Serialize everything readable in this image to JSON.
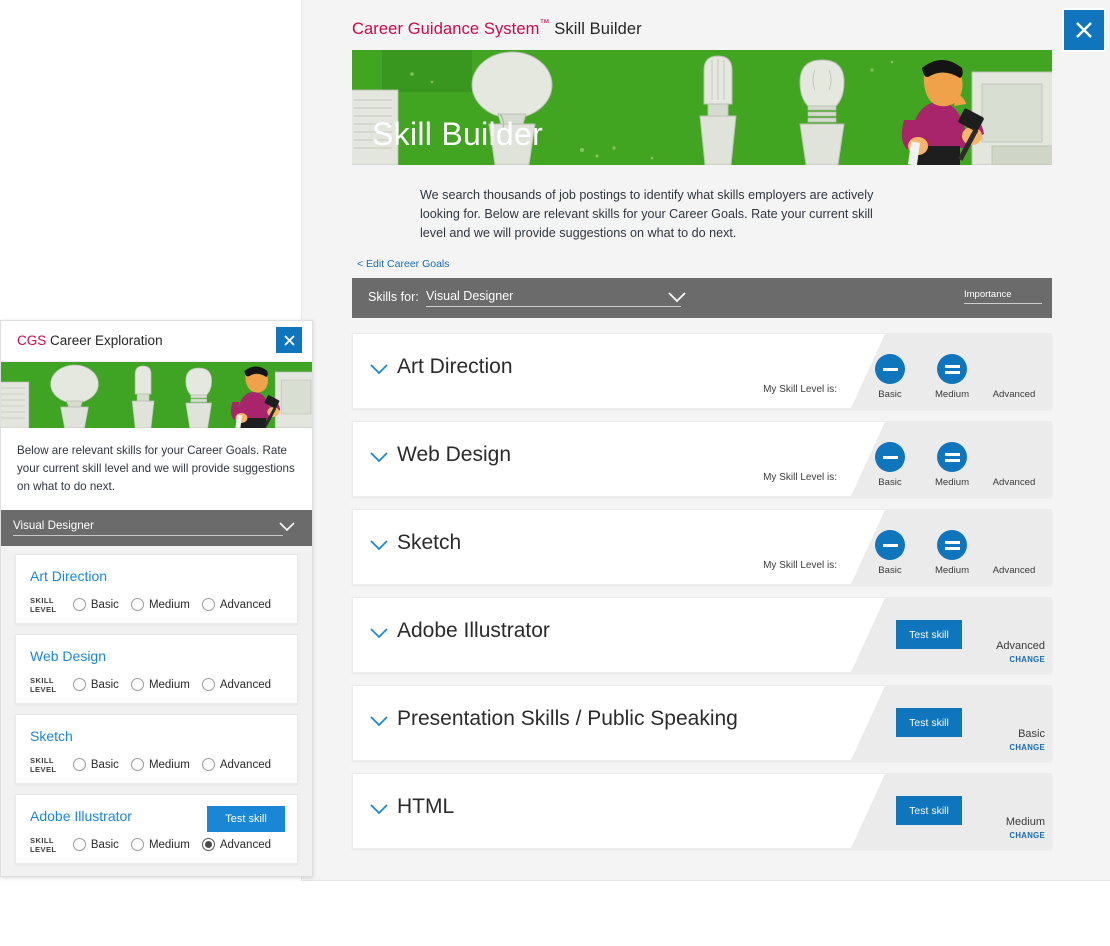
{
  "main": {
    "title_brand": "Career Guidance System",
    "title_tm": "™",
    "title_rest": " Skill Builder",
    "close_label": "close-icon",
    "hero_label": "Skill Builder",
    "intro": "We search thousands of job postings to identify what skills employers are actively looking for. Below are relevant skills for your Career Goals. Rate your current skill level and we will provide suggestions on what to do next.",
    "edit_goals": "< Edit Career Goals",
    "skills_for_label": "Skills for:",
    "skills_for_value": "Visual Designer",
    "importance_label": "Importance",
    "my_skill_level_label": "My Skill Level is:",
    "test_skill_label": "Test skill",
    "change_label": "CHANGE",
    "levels": [
      "Basic",
      "Medium",
      "Advanced"
    ],
    "rows": [
      {
        "name": "Art Direction",
        "mode": "rate"
      },
      {
        "name": "Web Design",
        "mode": "rate"
      },
      {
        "name": "Sketch",
        "mode": "rate"
      },
      {
        "name": "Adobe Illustrator",
        "mode": "tested",
        "result": "Advanced"
      },
      {
        "name": "Presentation Skills / Public Speaking",
        "mode": "tested",
        "result": "Basic"
      },
      {
        "name": "HTML",
        "mode": "tested",
        "result": "Medium"
      }
    ]
  },
  "side": {
    "title_brand": "CGS",
    "title_rest": " Career Exploration",
    "close_label": "close-icon",
    "intro": "Below are relevant skills for your Career Goals. Rate your current skill level and we will provide suggestions on what to do next.",
    "select_value": "Visual Designer",
    "skill_level_caption": "SKILL LEVEL",
    "test_skill_label": "Test skill",
    "levels": [
      "Basic",
      "Medium",
      "Advanced"
    ],
    "cards": [
      {
        "name": "Art Direction",
        "selected": null,
        "has_test": false
      },
      {
        "name": "Web Design",
        "selected": null,
        "has_test": false
      },
      {
        "name": "Sketch",
        "selected": null,
        "has_test": false
      },
      {
        "name": "Adobe Illustrator",
        "selected": "Advanced",
        "has_test": true
      }
    ]
  },
  "colors": {
    "brand_red": "#cc0a4b",
    "accent_blue": "#0f75bc",
    "link_blue": "#1a6bb5",
    "hero_green": "#3fa324",
    "bar_gray": "#6b6b6b"
  }
}
